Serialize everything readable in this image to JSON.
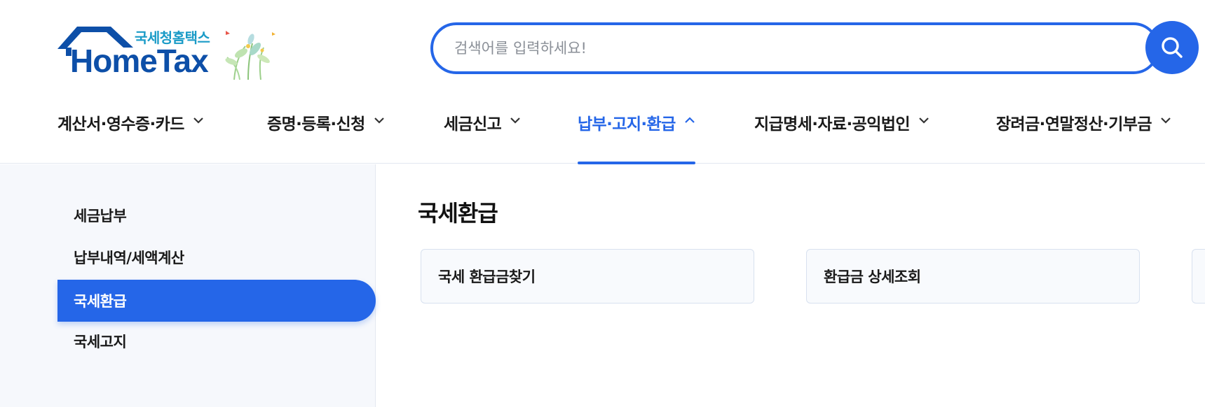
{
  "brand": {
    "sub_label": "국세청홈택스",
    "main_label": "HomeTax",
    "colors": {
      "primary": "#2566e8",
      "logo_blue": "#0d4fa8",
      "logo_sub": "#1a9bc7"
    }
  },
  "search": {
    "placeholder": "검색어를 입력하세요!",
    "value": "",
    "button_icon": "search-icon"
  },
  "gnb": [
    {
      "label": "계산서·영수증·카드",
      "expanded": false
    },
    {
      "label": "증명·등록·신청",
      "expanded": false
    },
    {
      "label": "세금신고",
      "expanded": false
    },
    {
      "label": "납부·고지·환급",
      "expanded": true
    },
    {
      "label": "지급명세·자료·공익법인",
      "expanded": false
    },
    {
      "label": "장려금·연말정산·기부금",
      "expanded": false
    }
  ],
  "lnb": [
    {
      "label": "세금납부",
      "active": false
    },
    {
      "label": "납부내역/세액계산",
      "active": false
    },
    {
      "label": "국세환급",
      "active": true
    },
    {
      "label": "국세고지",
      "active": false
    }
  ],
  "content": {
    "title": "국세환급",
    "cards": [
      {
        "label": "국세 환급금찾기"
      },
      {
        "label": "환급금 상세조회"
      },
      {
        "label": ""
      }
    ]
  }
}
